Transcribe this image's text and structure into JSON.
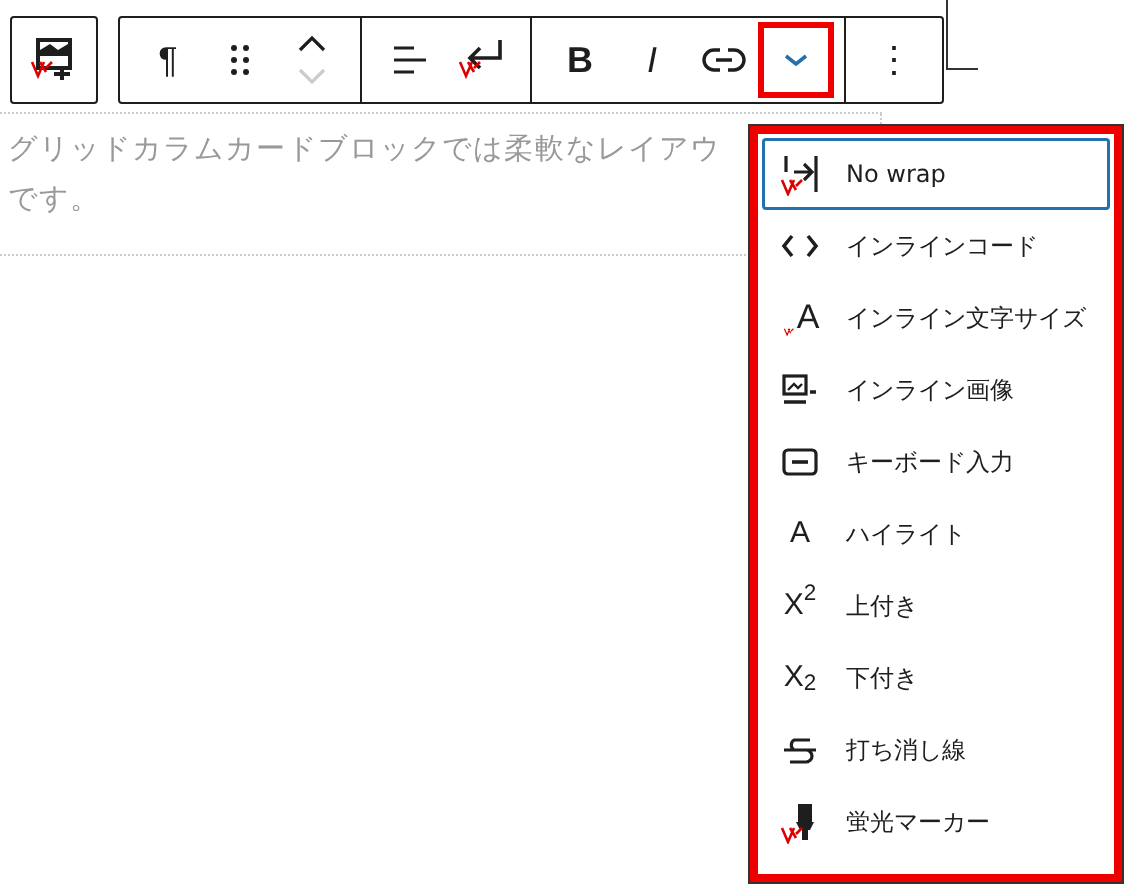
{
  "toolbar": {
    "groups": [
      {
        "buttons": [
          {
            "kind": "block-type"
          }
        ]
      },
      {
        "buttons": [
          {
            "kind": "text",
            "label": "¶"
          },
          {
            "kind": "drag"
          },
          {
            "kind": "move"
          }
        ]
      },
      {
        "buttons": [
          {
            "kind": "align"
          },
          {
            "kind": "return"
          }
        ]
      },
      {
        "buttons": [
          {
            "kind": "bold",
            "label": "B"
          },
          {
            "kind": "italic",
            "label": "I"
          },
          {
            "kind": "link"
          },
          {
            "kind": "dropdown",
            "expanded": true,
            "highlighted": true
          }
        ]
      },
      {
        "buttons": [
          {
            "kind": "text",
            "label": "⋮"
          }
        ]
      }
    ]
  },
  "paragraph": {
    "lines": [
      "グリッドカラムカードブロックでは柔軟なレイアウ",
      "です。"
    ]
  },
  "menu": {
    "highlighted": true,
    "items": [
      {
        "kind": "nowrap",
        "label": "No wrap",
        "selected": true
      },
      {
        "kind": "code",
        "label": "インラインコード",
        "selected": false
      },
      {
        "kind": "fontsize",
        "glyph": "A",
        "label": "インライン文字サイズ",
        "selected": false
      },
      {
        "kind": "image",
        "label": "インライン画像",
        "selected": false
      },
      {
        "kind": "keyboard",
        "label": "キーボード入力",
        "selected": false
      },
      {
        "kind": "glyph",
        "glyph": "A",
        "label": "ハイライト",
        "selected": false
      },
      {
        "kind": "glyph",
        "glyph": "X$^{2}$",
        "label": "上付き",
        "selected": false
      },
      {
        "kind": "glyph",
        "glyph": "X$_{2}$",
        "label": "下付き",
        "selected": false
      },
      {
        "kind": "strike",
        "label": "打ち消し線",
        "selected": false
      },
      {
        "kind": "marker",
        "label": "蛍光マーカー",
        "selected": false
      }
    ]
  }
}
